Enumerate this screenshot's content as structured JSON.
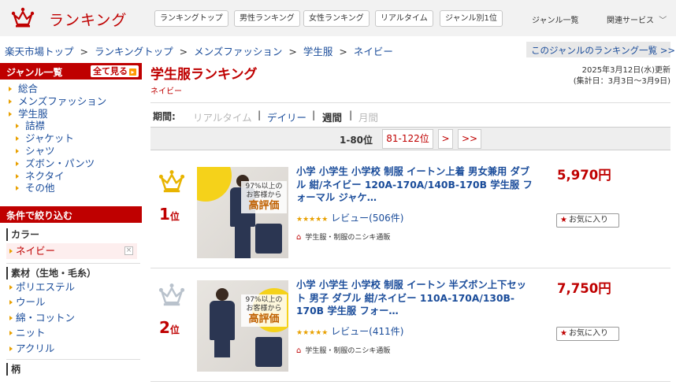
{
  "header": {
    "logo_text": "ランキング",
    "nav_buttons": [
      "ランキングトップ",
      "男性ランキング",
      "女性ランキング",
      "リアルタイム",
      "ジャンル別1位"
    ],
    "nav_plain": [
      "ジャンル一覧",
      "関連サービス"
    ],
    "nav_chevron": "﹀"
  },
  "breadcrumb": [
    "楽天市場トップ",
    "ランキングトップ",
    "メンズファッション",
    "学生服",
    "ネイビー"
  ],
  "breadcrumb_sep": ">",
  "genre_ranking_link": "このジャンルのランキング一覧 >>",
  "sidebar": {
    "genre_head": "ジャンル一覧",
    "see_all": "全て見る",
    "see_all_arrow": "▸",
    "genres": [
      {
        "label": "総合",
        "level": 1
      },
      {
        "label": "メンズファッション",
        "level": 1
      },
      {
        "label": "学生服",
        "level": 1
      },
      {
        "label": "詰襟",
        "level": 2
      },
      {
        "label": "ジャケット",
        "level": 2
      },
      {
        "label": "シャツ",
        "level": 2
      },
      {
        "label": "ズボン・パンツ",
        "level": 2
      },
      {
        "label": "ネクタイ",
        "level": 2
      },
      {
        "label": "その他",
        "level": 2
      }
    ],
    "filter_head": "条件で絞り込む",
    "color_section": "カラー",
    "color_selected": "ネイビー",
    "remove_icon": "×",
    "material_section": "素材（生地・毛糸）",
    "materials": [
      "ポリエステル",
      "ウール",
      "綿・コットン",
      "ニット",
      "アクリル"
    ],
    "pattern_section": "柄"
  },
  "main": {
    "title": "学生服ランキング",
    "subtitle": "ネイビー",
    "updated": "2025年3月12日(水)更新",
    "period_range": "(集計日：3月3日〜3月9日)",
    "period_label": "期間:",
    "periods": [
      "リアルタイム",
      "デイリー",
      "週間",
      "月間"
    ],
    "period_sep": "|",
    "pager_current": "1-80位",
    "pager_next_range": "81-122位",
    "pager_next": ">",
    "pager_last": ">>"
  },
  "items": [
    {
      "rank": "1",
      "rank_suffix": "位",
      "title": "小学 小学生 小学校 制服 イートン上着 男女兼用 ダブル 紺/ネイビー 120A-170A/140B-170B 学生服 フォーマル ジャケ…",
      "price": "5,970円",
      "stars": "★★★★★",
      "review": "レビュー(506件)",
      "shop": "学生服・制服のニシキ通販",
      "fav": "お気に入り",
      "badge_top": "97%以上の",
      "badge_mid": "お客様から",
      "badge_big": "高評価",
      "crown_color": "#e8b400"
    },
    {
      "rank": "2",
      "rank_suffix": "位",
      "title": "小学 小学生 小学校 制服 イートン 半ズボン上下セット 男子 ダブル 紺/ネイビー 110A-170A/130B-170B 学生服 フォー…",
      "price": "7,750円",
      "stars": "★★★★★",
      "review": "レビュー(411件)",
      "shop": "学生服・制服のニシキ通販",
      "fav": "お気に入り",
      "badge_top": "97%以上の",
      "badge_mid": "お客様から",
      "badge_big": "高評価",
      "crown_color": "#b9c2cc"
    }
  ],
  "colors": {
    "accent": "#bf0000",
    "link": "#1a4c9a",
    "star": "#e8a000"
  },
  "icons": [
    "crown-logo-icon",
    "chevron-down-icon",
    "triangle-bullet-icon",
    "close-icon",
    "crown-gold-icon",
    "crown-silver-icon",
    "home-icon",
    "star-icon"
  ]
}
